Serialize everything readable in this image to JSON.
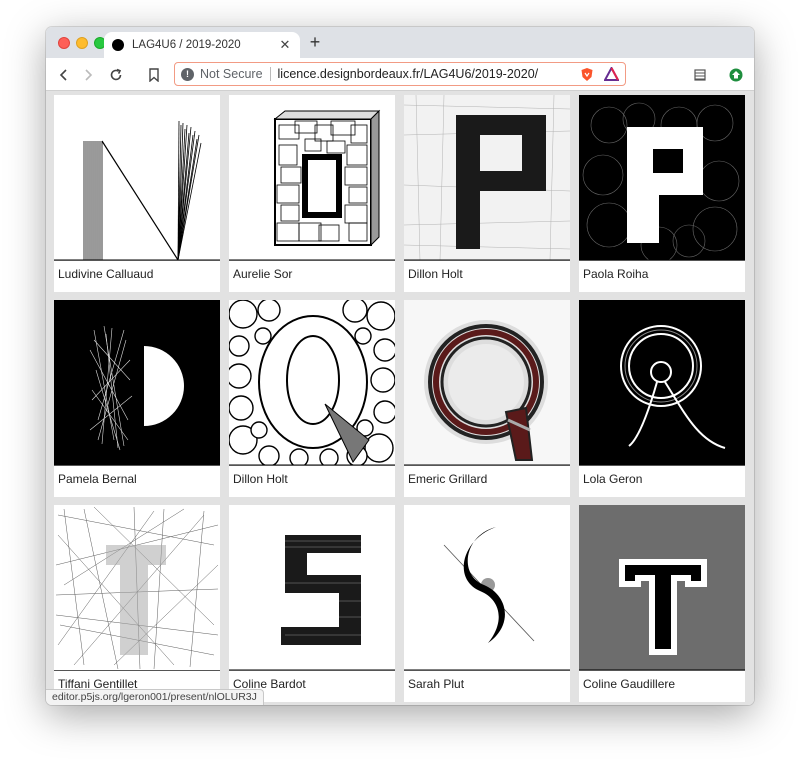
{
  "tab": {
    "title": "LAG4U6 / 2019-2020",
    "close_icon": "close-icon",
    "new_tab_symbol": "+"
  },
  "address": {
    "security_label": "Not Secure",
    "url": "licence.designbordeaux.fr/LAG4U6/2019-2020/"
  },
  "gallery": [
    {
      "author": "Ludivine Calluaud",
      "letter": "N"
    },
    {
      "author": "Aurelie Sor",
      "letter": "O"
    },
    {
      "author": "Dillon Holt",
      "letter": "P"
    },
    {
      "author": "Paola Roiha",
      "letter": "P"
    },
    {
      "author": "Pamela Bernal",
      "letter": "P"
    },
    {
      "author": "Dillon Holt",
      "letter": "Q"
    },
    {
      "author": "Emeric Grillard",
      "letter": "Q"
    },
    {
      "author": "Lola Geron",
      "letter": "R"
    },
    {
      "author": "Tiffani Gentillet",
      "letter": "R"
    },
    {
      "author": "Coline Bardot",
      "letter": "S"
    },
    {
      "author": "Sarah Plut",
      "letter": "S"
    },
    {
      "author": "Coline Gaudillere",
      "letter": "T"
    }
  ],
  "status_bar": {
    "link": "editor.p5js.org/lgeron001/present/nlOLUR3J"
  },
  "colors": {
    "tabstrip": "#dee1e6",
    "omnibox_border": "#f29b84",
    "brave_orange": "#fb542b",
    "grid_bg": "#e2e2e2"
  }
}
